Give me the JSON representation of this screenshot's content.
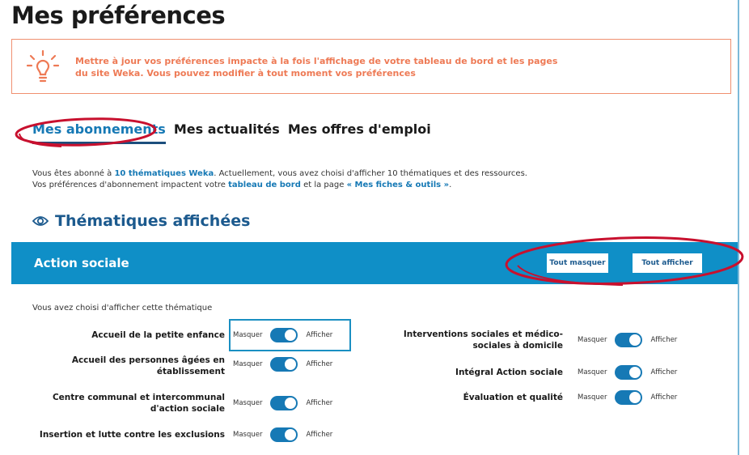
{
  "page": {
    "title": "Mes préférences"
  },
  "info": {
    "icon": "lightbulb-icon",
    "text_line1": "Mettre à jour vos préférences impacte à la fois l'affichage de votre tableau de bord et les pages",
    "text_line2": "du site Weka. Vous pouvez modifier à tout moment vos préférences"
  },
  "tabs": [
    {
      "label": "Mes abonnements",
      "active": true
    },
    {
      "label": "Mes actualités",
      "active": false
    },
    {
      "label": "Mes offres d'emploi",
      "active": false
    }
  ],
  "subscription": {
    "line1_pre": "Vous êtes abonné à ",
    "line1_bold": "10 thématiques Weka",
    "line1_post": ". Actuellement, vous avez choisi d'afficher 10 thématiques et des ressources.",
    "line2_pre": "Vos préférences d'abonnement impactent votre ",
    "line2_link1": "tableau de bord",
    "line2_mid": " et la page ",
    "line2_link2": "« Mes fiches & outils »",
    "line2_post": "."
  },
  "section": {
    "icon": "eye-icon",
    "title": "Thématiques affichées"
  },
  "banner": {
    "title": "Action sociale",
    "mask_all": "Tout masquer",
    "show_all": "Tout afficher"
  },
  "chosen_text": "Vous avez choisi d'afficher cette thématique",
  "toggle_labels": {
    "off": "Masquer",
    "on": "Afficher"
  },
  "left_prefs": [
    {
      "label": "Accueil de la petite enfance",
      "on": true
    },
    {
      "label": "Accueil des personnes âgées en établissement",
      "on": true
    },
    {
      "label": "Centre communal et intercommunal d'action sociale",
      "on": true
    },
    {
      "label": "Insertion et lutte contre les exclusions",
      "on": true
    }
  ],
  "right_prefs": [
    {
      "label": "Interventions sociales et médico-sociales à domicile",
      "on": true
    },
    {
      "label": "Intégral Action sociale",
      "on": true
    },
    {
      "label": "Évaluation et qualité",
      "on": true
    }
  ],
  "colors": {
    "accent": "#1679b5",
    "banner": "#0f8fc7",
    "warning": "#ee7a55",
    "annotation": "#c8102e"
  }
}
